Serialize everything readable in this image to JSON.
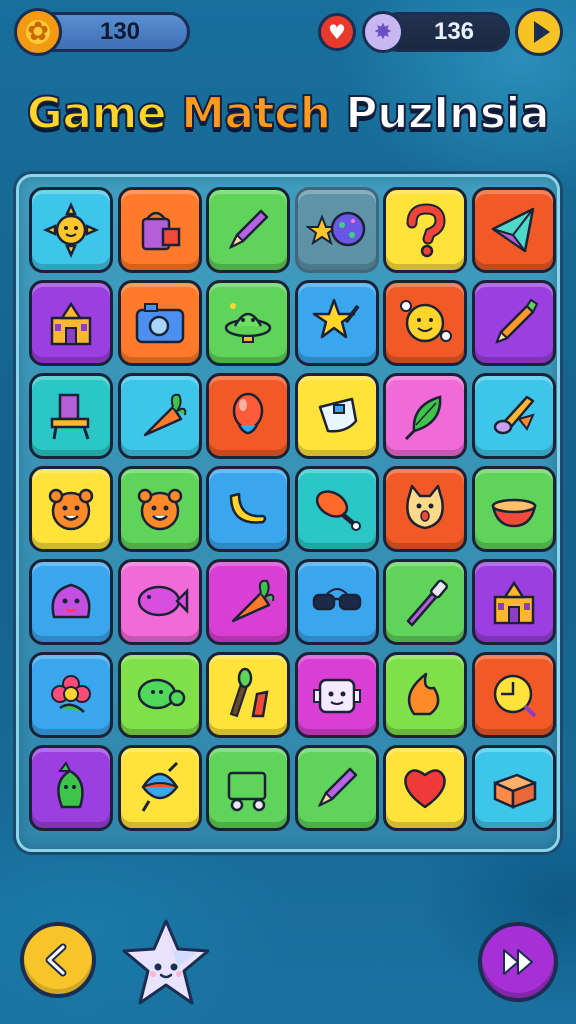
{
  "hud": {
    "coins": "130",
    "gems": "136",
    "coin_icon": "gear-icon",
    "heart_icon": "heart-icon",
    "gem_icon": "gem-icon",
    "play_icon": "play-icon"
  },
  "title": {
    "part1": "Game",
    "part2": "Match",
    "part3": "PuzInsia"
  },
  "colors": {
    "cyan": "#3ec6ea",
    "orange": "#ff7a2a",
    "green": "#5fd35a",
    "yellow": "#ffe23a",
    "red": "#f2562a",
    "purple": "#9b3fe0",
    "pink": "#f06bd7",
    "teal": "#2bc7c7",
    "lime": "#7fe04a",
    "blue": "#3aa6ee",
    "magenta": "#d93fd4",
    "orangeRed": "#f15a26"
  },
  "grid": [
    [
      {
        "c": "cyan",
        "icon": "sun-icon"
      },
      {
        "c": "orange",
        "icon": "bucket-icon"
      },
      {
        "c": "green",
        "icon": "pencil-icon"
      },
      {
        "c": "empty",
        "icon": "star-ball-icon"
      },
      {
        "c": "yellow",
        "icon": "question-mark-icon"
      },
      {
        "c": "orangeRed",
        "icon": "kite-icon"
      }
    ],
    [
      {
        "c": "purple",
        "icon": "house-icon"
      },
      {
        "c": "orange",
        "icon": "camera-icon"
      },
      {
        "c": "green",
        "icon": "ufo-icon"
      },
      {
        "c": "blue",
        "icon": "star-wand-icon"
      },
      {
        "c": "orangeRed",
        "icon": "smiley-ball-icon"
      },
      {
        "c": "purple",
        "icon": "crayon-icon"
      }
    ],
    [
      {
        "c": "teal",
        "icon": "chair-icon"
      },
      {
        "c": "cyan",
        "icon": "carrot-icon"
      },
      {
        "c": "orangeRed",
        "icon": "balloon-icon"
      },
      {
        "c": "yellow",
        "icon": "bag-icon"
      },
      {
        "c": "pink",
        "icon": "leaf-broom-icon"
      },
      {
        "c": "cyan",
        "icon": "paintbrush-icon"
      }
    ],
    [
      {
        "c": "yellow",
        "icon": "bear-face-icon"
      },
      {
        "c": "green",
        "icon": "bear-face-icon"
      },
      {
        "c": "blue",
        "icon": "banana-icon"
      },
      {
        "c": "teal",
        "icon": "drumstick-icon"
      },
      {
        "c": "orangeRed",
        "icon": "cat-face-icon"
      },
      {
        "c": "green",
        "icon": "bowl-icon"
      }
    ],
    [
      {
        "c": "blue",
        "icon": "blob-icon"
      },
      {
        "c": "pink",
        "icon": "fish-icon"
      },
      {
        "c": "magenta",
        "icon": "carrot-icon"
      },
      {
        "c": "blue",
        "icon": "sunglasses-icon"
      },
      {
        "c": "green",
        "icon": "screwdriver-icon"
      },
      {
        "c": "purple",
        "icon": "house-icon"
      }
    ],
    [
      {
        "c": "blue",
        "icon": "flower-icon"
      },
      {
        "c": "lime",
        "icon": "turtle-icon"
      },
      {
        "c": "yellow",
        "icon": "brushes-icon"
      },
      {
        "c": "magenta",
        "icon": "robot-face-icon"
      },
      {
        "c": "lime",
        "icon": "flame-icon"
      },
      {
        "c": "orangeRed",
        "icon": "lemon-icon"
      }
    ],
    [
      {
        "c": "purple",
        "icon": "cactus-icon"
      },
      {
        "c": "yellow",
        "icon": "spinning-top-icon"
      },
      {
        "c": "green",
        "icon": "cart-icon"
      },
      {
        "c": "green",
        "icon": "pencil-icon"
      },
      {
        "c": "yellow",
        "icon": "heart-icon"
      },
      {
        "c": "cyan",
        "icon": "box-icon"
      }
    ]
  ],
  "bottom": {
    "back_icon": "chevron-left-icon",
    "mascot_icon": "star-mascot-icon",
    "forward_icon": "fast-forward-icon"
  }
}
